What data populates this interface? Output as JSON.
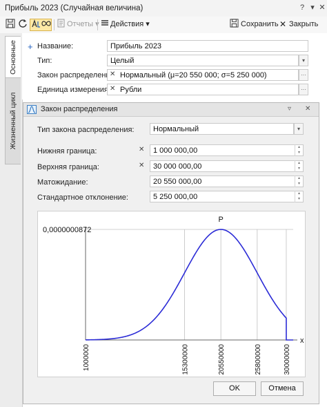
{
  "window": {
    "title": "Прибыль 2023 (Случайная величина)",
    "help": "?",
    "pin": "▾",
    "close": "✕"
  },
  "toolbar": {
    "reports": "Отчеты",
    "actions": "Действия",
    "save": "Сохранить",
    "close": "Закрыть"
  },
  "tabs": [
    "Основные",
    "Жизненный цикл"
  ],
  "form": {
    "name_label": "Название:",
    "name_value": "Прибыль 2023",
    "type_label": "Тип:",
    "type_value": "Целый",
    "dist_label": "Закон распределения:",
    "dist_value": "Нормальный (μ=20 550 000; σ=5 250 000)",
    "unit_label": "Единица измерения:",
    "unit_value": "Рубли"
  },
  "dialog": {
    "title": "Закон распределения",
    "law_type_label": "Тип закона распределения:",
    "law_type_value": "Нормальный",
    "lower_label": "Нижняя граница:",
    "lower_value": "1 000 000,00",
    "upper_label": "Верхняя граница:",
    "upper_value": "30 000 000,00",
    "mean_label": "Матожидание:",
    "mean_value": "20 550 000,00",
    "std_label": "Стандартное отклонение:",
    "std_value": "5 250 000,00",
    "ok": "OK",
    "cancel": "Отмена"
  },
  "chart_data": {
    "type": "line",
    "title": "P",
    "xlabel": "x",
    "ylabel": "",
    "ymax_label": "0,0000000872",
    "distribution": "normal",
    "mean": 20550000,
    "std": 5250000,
    "lower": 1000000,
    "upper": 30000000,
    "xlim": [
      1000000,
      31000000
    ],
    "ylim": [
      0,
      8.72e-08
    ],
    "x_ticks": [
      1000000,
      15300000,
      20550000,
      25800000,
      30000000
    ],
    "x_tick_labels": [
      "1000000",
      "15300000",
      "20550000",
      "25800000",
      "30000000"
    ],
    "series": [
      {
        "color": "#2b2bd6"
      }
    ],
    "grid": "vertical-at-ticks"
  },
  "colors": {
    "accent": "#2b2bd6",
    "grid": "#c0c0c0"
  }
}
